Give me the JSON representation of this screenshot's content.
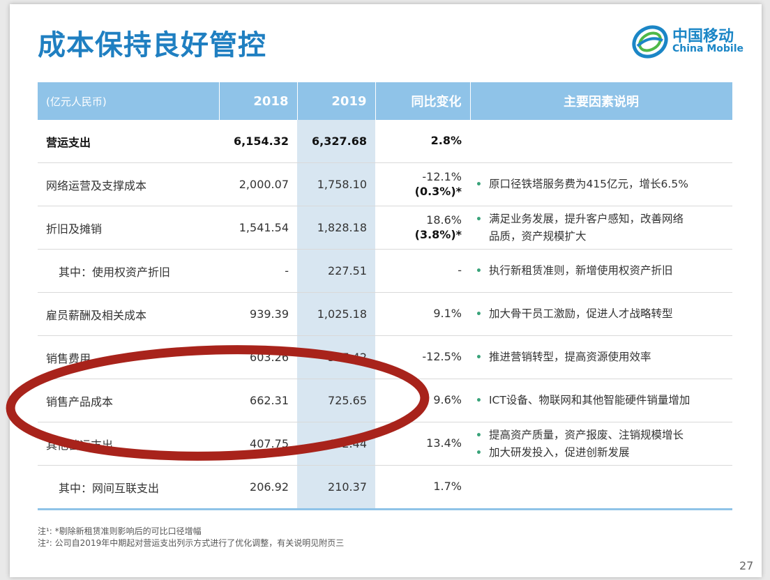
{
  "title": "成本保持良好管控",
  "logo": {
    "cn": "中国移动",
    "en": "China Mobile"
  },
  "table": {
    "headers": [
      "(亿元人民币)",
      "2018",
      "2019",
      "同比变化",
      "主要因素说明"
    ],
    "rows": [
      {
        "label": "营运支出",
        "v2018": "6,154.32",
        "v2019": "6,327.68",
        "change": "2.8%",
        "change_sub": "",
        "notes": []
      },
      {
        "label": "网络运营及支撑成本",
        "v2018": "2,000.07",
        "v2019": "1,758.10",
        "change": "-12.1%",
        "change_sub": "(0.3%)*",
        "notes": [
          "原口径铁塔服务费为415亿元，增长6.5%"
        ]
      },
      {
        "label": "折旧及摊销",
        "v2018": "1,541.54",
        "v2019": "1,828.18",
        "change": "18.6%",
        "change_sub": "(3.8%)*",
        "notes": [
          "满足业务发展，提升客户感知，改善网络",
          "品质，资产规模扩大"
        ]
      },
      {
        "label": "其中：使用权资产折旧",
        "v2018": "-",
        "v2019": "227.51",
        "change": "-",
        "change_sub": "",
        "notes": [
          "执行新租赁准则，新增使用权资产折旧"
        ]
      },
      {
        "label": "雇员薪酬及相关成本",
        "v2018": "939.39",
        "v2019": "1,025.18",
        "change": "9.1%",
        "change_sub": "",
        "notes": [
          "加大骨干员工激励，促进人才战略转型"
        ]
      },
      {
        "label": "销售费用",
        "v2018": "603.26",
        "v2019": "527.42",
        "change": "-12.5%",
        "change_sub": "",
        "notes": [
          "推进营销转型，提高资源使用效率"
        ]
      },
      {
        "label": "销售产品成本",
        "v2018": "662.31",
        "v2019": "725.65",
        "change": "9.6%",
        "change_sub": "",
        "notes": [
          "ICT设备、物联网和其他智能硬件销量增加"
        ]
      },
      {
        "label": "其他营运支出",
        "v2018": "407.75",
        "v2019": "462.44",
        "change": "13.4%",
        "change_sub": "",
        "notes": [
          "提高资产质量，资产报废、注销规模增长",
          "加大研发投入，促进创新发展"
        ]
      },
      {
        "label": "其中：网间互联支出",
        "v2018": "206.92",
        "v2019": "210.37",
        "change": "1.7%",
        "change_sub": "",
        "notes": []
      }
    ]
  },
  "footnotes": [
    "注¹: *剔除新租赁准则影响后的可比口径增幅",
    "注²: 公司自2019年中期起对营运支出列示方式进行了优化调整，有关说明见附页三"
  ],
  "page_number": "27",
  "colors": {
    "title": "#1f7fc1",
    "header_bg": "#8fc3e8",
    "highlight_col": "#d8e6f1",
    "bullet": "#3aa37a",
    "annotation": "#a8231b"
  }
}
